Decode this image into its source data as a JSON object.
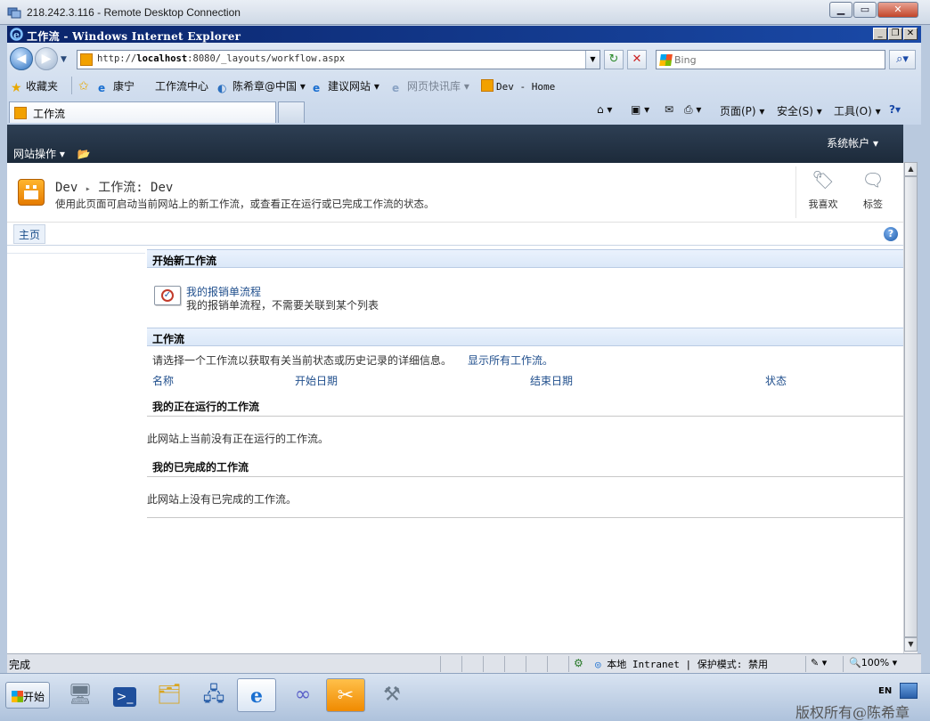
{
  "rdc": {
    "title": "218.242.3.116 - Remote Desktop Connection"
  },
  "ie": {
    "title": "工作流 - Windows Internet Explorer",
    "address": {
      "prefix": "http://",
      "host": "localhost",
      "rest": ":8080/_layouts/workflow.aspx"
    },
    "search_placeholder": "Bing",
    "favorites": {
      "label": "收藏夹",
      "items": [
        "康宁",
        "工作流中心",
        "陈希章@中国",
        "建议网站",
        "网页快讯库",
        "Dev - Home"
      ]
    },
    "tab_title": "工作流",
    "commands": {
      "page": "页面(P)",
      "safety": "安全(S)",
      "tools": "工具(O)"
    }
  },
  "sp": {
    "site_actions": "网站操作",
    "system_account": "系统帐户",
    "breadcrumb": {
      "site": "Dev",
      "separator": "▸",
      "page": "工作流: Dev"
    },
    "description": "使用此页面可启动当前网站上的新工作流，或查看正在运行或已完成工作流的状态。",
    "social": {
      "like": "我喜欢",
      "tags": "标签"
    },
    "nav": {
      "home": "主页"
    },
    "start_section": {
      "title": "开始新工作流",
      "item_name": "我的报销单流程",
      "item_desc": "我的报销单流程，不需要关联到某个列表"
    },
    "workflows_section": {
      "title": "工作流",
      "instruction": "请选择一个工作流以获取有关当前状态或历史记录的详细信息。",
      "show_all": "显示所有工作流。",
      "columns": [
        "名称",
        "开始日期",
        "结束日期",
        "状态"
      ],
      "running_title": "我的正在运行的工作流",
      "running_empty": "此网站上当前没有正在运行的工作流。",
      "completed_title": "我的已完成的工作流",
      "completed_empty": "此网站上没有已完成的工作流。"
    }
  },
  "statusbar": {
    "status": "完成",
    "zone": "本地 Intranet | 保护模式: 禁用",
    "zoom": "100%"
  },
  "taskbar": {
    "start": "开始",
    "lang": "EN",
    "copyright": "版权所有@陈希章"
  }
}
